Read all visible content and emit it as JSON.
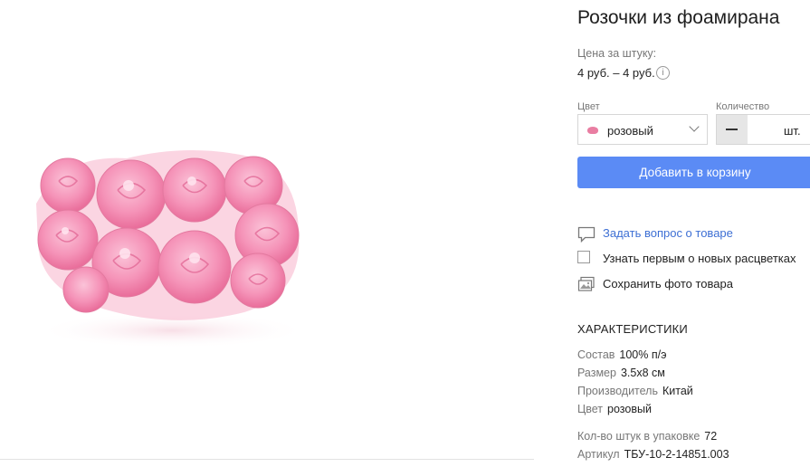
{
  "product": {
    "title": "Розочки из фоамирана",
    "price_label": "Цена за штуку:",
    "price_value": "4 руб. – 4 руб.",
    "info_icon": "info-icon",
    "image_alt": "product-photo"
  },
  "options": {
    "color_label": "Цвет",
    "color_value": "розовый",
    "color_swatch": "#e97ea2",
    "quantity_label": "Количество",
    "quantity_unit": "шт."
  },
  "buttons": {
    "add_to_cart": "Добавить в корзину"
  },
  "actions": {
    "ask_question": "Задать вопрос о товаре",
    "notify_colors": "Узнать первым о новых расцветках",
    "save_photo": "Сохранить фото товара"
  },
  "specs": {
    "heading": "ХАРАКТЕРИСТИКИ",
    "rows": [
      {
        "key": "Состав",
        "value": "100% п/э"
      },
      {
        "key": "Размер",
        "value": "3.5x8 см"
      },
      {
        "key": "Производитель",
        "value": "Китай"
      },
      {
        "key": "Цвет",
        "value": "розовый"
      },
      {
        "key": "Кол-во штук в упаковке",
        "value": "72"
      },
      {
        "key": "Артикул",
        "value": "ТБУ-10-2-14851.003"
      }
    ]
  },
  "colors": {
    "accent": "#5b8bf5",
    "link": "#3d6fd4",
    "rose_pink": "#f590b7"
  }
}
